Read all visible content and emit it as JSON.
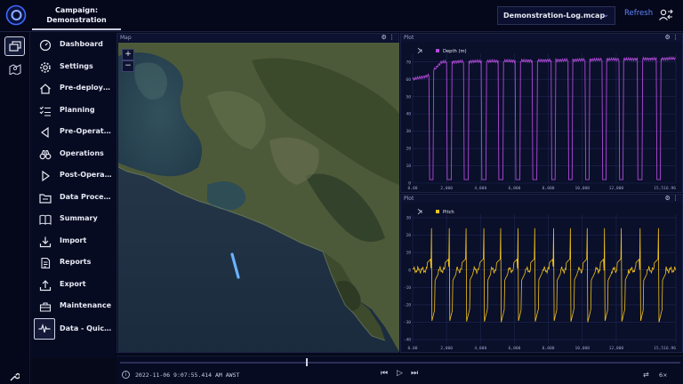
{
  "header": {
    "campaign_label": "Campaign:",
    "campaign_name": "Demonstration",
    "file_name": "Demonstration-Log.mcap",
    "refresh_label": "Refresh"
  },
  "nav": {
    "items": [
      {
        "label": "Dashboard",
        "icon": "dashboard-icon"
      },
      {
        "label": "Settings",
        "icon": "gear-icon"
      },
      {
        "label": "Pre-deployment",
        "icon": "home-icon"
      },
      {
        "label": "Planning",
        "icon": "checklist-icon"
      },
      {
        "label": "Pre-Operation",
        "icon": "triangle-left-icon"
      },
      {
        "label": "Operations",
        "icon": "binoculars-icon"
      },
      {
        "label": "Post-Operation",
        "icon": "triangle-right-icon"
      },
      {
        "label": "Data Processing",
        "icon": "folder-icon"
      },
      {
        "label": "Summary",
        "icon": "book-icon"
      },
      {
        "label": "Import",
        "icon": "download-icon"
      },
      {
        "label": "Reports",
        "icon": "document-icon"
      },
      {
        "label": "Export",
        "icon": "upload-icon"
      },
      {
        "label": "Maintenance",
        "icon": "toolbox-icon"
      },
      {
        "label": "Data - Quick Plot",
        "icon": "pulse-icon"
      }
    ]
  },
  "map": {
    "title": "Map",
    "zoom_in": "+",
    "zoom_out": "−"
  },
  "plots": [
    {
      "title": "Plot",
      "series_name": "Depth (m)"
    },
    {
      "title": "Plot",
      "series_name": "Pitch"
    }
  ],
  "timeline": {
    "timestamp": "2022-11-06 9:07:55.414 AM AWST",
    "speed": "6×"
  },
  "colors": {
    "accent": "#5d86ff",
    "depth_series": "#b04ad8",
    "pitch_series": "#f2c21a",
    "panel_bg": "#0a0f2a"
  },
  "chart_data": [
    {
      "type": "line",
      "series": [
        {
          "name": "Depth (m)",
          "color": "#b04ad8"
        }
      ],
      "x_ticks": [
        "0.00",
        "2,000",
        "4,000",
        "6,000",
        "8,000",
        "10,000",
        "12,000",
        "15,516.96"
      ],
      "y_ticks": [
        "0",
        "10",
        "20",
        "30",
        "40",
        "50",
        "60",
        "70"
      ],
      "ylim": [
        0,
        75
      ],
      "xlim": [
        0,
        15516.96
      ],
      "baseline_segments": [
        [
          0,
          900,
          60,
          62
        ],
        [
          900,
          1700,
          62,
          70
        ],
        [
          1700,
          15516.96,
          70,
          72
        ]
      ],
      "dips": [
        1100,
        2150,
        3150,
        4200,
        5200,
        6200,
        7200,
        8300,
        9300,
        10300,
        11300,
        12300,
        13400,
        14500
      ],
      "dip_value": 2,
      "grid": true
    },
    {
      "type": "line",
      "series": [
        {
          "name": "Pitch",
          "color": "#f2c21a"
        }
      ],
      "x_ticks": [
        "0.00",
        "2,000",
        "4,000",
        "6,000",
        "8,000",
        "10,000",
        "12,000",
        "15,516.96"
      ],
      "y_ticks": [
        "-40",
        "-30",
        "-20",
        "-10",
        "0",
        "10",
        "20",
        "30"
      ],
      "ylim": [
        -42,
        32
      ],
      "xlim": [
        0,
        15516.96
      ],
      "spikes": [
        1100,
        2150,
        3150,
        4200,
        5200,
        6200,
        7200,
        8300,
        9300,
        10300,
        11300,
        12300,
        13400,
        14500
      ],
      "spike_high": 24,
      "spike_low": -30,
      "baseline": 0,
      "grid": true
    }
  ]
}
